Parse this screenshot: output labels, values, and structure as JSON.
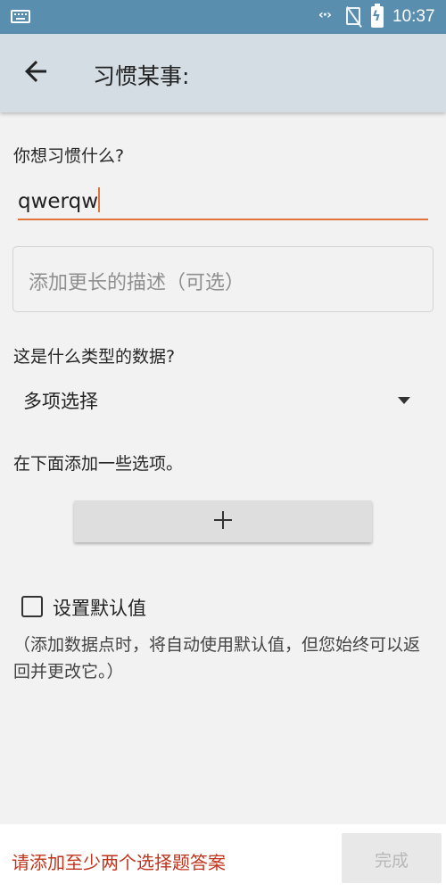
{
  "status_bar": {
    "time": "10:37",
    "sync_glyph": "‹·›",
    "icons": [
      "keyboard-icon",
      "sync-icon",
      "no-signal-icon",
      "battery-charging-icon"
    ]
  },
  "app_bar": {
    "title": "习惯某事:",
    "back_icon": "arrow-left-icon"
  },
  "form": {
    "name_question": "你想习惯什么?",
    "name_value": "qwerqw",
    "description_placeholder": "添加更长的描述（可选）",
    "type_question": "这是什么类型的数据?",
    "type_value": "多项选择",
    "options_prompt": "在下面添加一些选项。",
    "add_option_icon": "plus-icon",
    "default_checkbox_label": "设置默认值",
    "default_checkbox_checked": false,
    "default_hint": "（添加数据点时，将自动使用默认值，但您始终可以返回并更改它。）"
  },
  "bottom_bar": {
    "error_message": "请添加至少两个选择题答案",
    "done_label": "完成",
    "done_enabled": false
  },
  "colors": {
    "status_bar": "#5a8eae",
    "app_bar": "#d3dde3",
    "accent": "#e0743b",
    "error": "#c0341d"
  }
}
